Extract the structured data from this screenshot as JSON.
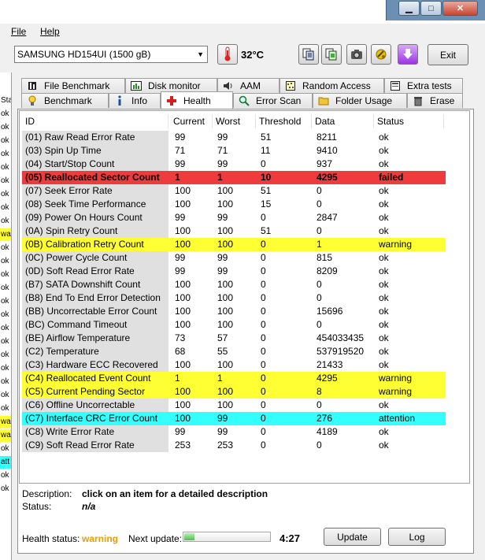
{
  "window": {
    "caption_buttons": {
      "minimize": "▁",
      "maximize": "□",
      "close": "✕"
    }
  },
  "menu": {
    "file": "File",
    "help": "Help"
  },
  "toolbar": {
    "drive": "SAMSUNG HD154UI (1500 gB)",
    "temperature": "32°C",
    "exit_label": "Exit",
    "icons": [
      "thermometer-icon",
      "copy-text-icon",
      "copy-image-icon",
      "camera-icon",
      "tools-icon",
      "download-icon"
    ]
  },
  "tabs": {
    "row1": [
      "File Benchmark",
      "Disk monitor",
      "AAM",
      "Random Access",
      "Extra tests"
    ],
    "row2": [
      "Benchmark",
      "Info",
      "Health",
      "Error Scan",
      "Folder Usage",
      "Erase"
    ],
    "active": "Health"
  },
  "table": {
    "columns": [
      "ID",
      "Current",
      "Worst",
      "Threshold",
      "Data",
      "Status"
    ],
    "rows": [
      {
        "id": "(01) Raw Read Error Rate",
        "current": "99",
        "worst": "99",
        "threshold": "51",
        "data": "8211",
        "status": "ok",
        "highlight": "none"
      },
      {
        "id": "(03) Spin Up Time",
        "current": "71",
        "worst": "71",
        "threshold": "11",
        "data": "9410",
        "status": "ok",
        "highlight": "none"
      },
      {
        "id": "(04) Start/Stop Count",
        "current": "99",
        "worst": "99",
        "threshold": "0",
        "data": "937",
        "status": "ok",
        "highlight": "none"
      },
      {
        "id": "(05) Reallocated Sector Count",
        "current": "1",
        "worst": "1",
        "threshold": "10",
        "data": "4295",
        "status": "failed",
        "highlight": "red"
      },
      {
        "id": "(07) Seek Error Rate",
        "current": "100",
        "worst": "100",
        "threshold": "51",
        "data": "0",
        "status": "ok",
        "highlight": "none"
      },
      {
        "id": "(08) Seek Time Performance",
        "current": "100",
        "worst": "100",
        "threshold": "15",
        "data": "0",
        "status": "ok",
        "highlight": "none"
      },
      {
        "id": "(09) Power On Hours Count",
        "current": "99",
        "worst": "99",
        "threshold": "0",
        "data": "2847",
        "status": "ok",
        "highlight": "none"
      },
      {
        "id": "(0A) Spin Retry Count",
        "current": "100",
        "worst": "100",
        "threshold": "51",
        "data": "0",
        "status": "ok",
        "highlight": "none"
      },
      {
        "id": "(0B) Calibration Retry Count",
        "current": "100",
        "worst": "100",
        "threshold": "0",
        "data": "1",
        "status": "warning",
        "highlight": "yellow"
      },
      {
        "id": "(0C) Power Cycle Count",
        "current": "99",
        "worst": "99",
        "threshold": "0",
        "data": "815",
        "status": "ok",
        "highlight": "none"
      },
      {
        "id": "(0D) Soft Read Error Rate",
        "current": "99",
        "worst": "99",
        "threshold": "0",
        "data": "8209",
        "status": "ok",
        "highlight": "none"
      },
      {
        "id": "(B7) SATA Downshift Count",
        "current": "100",
        "worst": "100",
        "threshold": "0",
        "data": "0",
        "status": "ok",
        "highlight": "none"
      },
      {
        "id": "(B8) End To End Error Detection",
        "current": "100",
        "worst": "100",
        "threshold": "0",
        "data": "0",
        "status": "ok",
        "highlight": "none"
      },
      {
        "id": "(BB) Uncorrectable Error Count",
        "current": "100",
        "worst": "100",
        "threshold": "0",
        "data": "15696",
        "status": "ok",
        "highlight": "none"
      },
      {
        "id": "(BC) Command Timeout",
        "current": "100",
        "worst": "100",
        "threshold": "0",
        "data": "0",
        "status": "ok",
        "highlight": "none"
      },
      {
        "id": "(BE) Airflow Temperature",
        "current": "73",
        "worst": "57",
        "threshold": "0",
        "data": "454033435",
        "status": "ok",
        "highlight": "none"
      },
      {
        "id": "(C2) Temperature",
        "current": "68",
        "worst": "55",
        "threshold": "0",
        "data": "537919520",
        "status": "ok",
        "highlight": "none"
      },
      {
        "id": "(C3) Hardware ECC Recovered",
        "current": "100",
        "worst": "100",
        "threshold": "0",
        "data": "21433",
        "status": "ok",
        "highlight": "none"
      },
      {
        "id": "(C4) Reallocated Event Count",
        "current": "1",
        "worst": "1",
        "threshold": "0",
        "data": "4295",
        "status": "warning",
        "highlight": "yellow"
      },
      {
        "id": "(C5) Current Pending Sector",
        "current": "100",
        "worst": "100",
        "threshold": "0",
        "data": "8",
        "status": "warning",
        "highlight": "yellow"
      },
      {
        "id": "(C6) Offline Uncorrectable",
        "current": "100",
        "worst": "100",
        "threshold": "0",
        "data": "0",
        "status": "ok",
        "highlight": "none"
      },
      {
        "id": "(C7) Interface CRC Error Count",
        "current": "100",
        "worst": "99",
        "threshold": "0",
        "data": "276",
        "status": "attention",
        "highlight": "cyan"
      },
      {
        "id": "(C8) Write Error Rate",
        "current": "99",
        "worst": "99",
        "threshold": "0",
        "data": "4189",
        "status": "ok",
        "highlight": "none"
      },
      {
        "id": "(C9) Soft Read Error Rate",
        "current": "253",
        "worst": "253",
        "threshold": "0",
        "data": "0",
        "status": "ok",
        "highlight": "none"
      }
    ]
  },
  "details": {
    "description_label": "Description:",
    "description_value": "click on an item for a detailed description",
    "status_label": "Status:",
    "status_value": "n/a"
  },
  "footer": {
    "health_label": "Health status:",
    "health_value": "warning",
    "next_update_label": "Next update:",
    "next_update_progress": 0.12,
    "next_update_time": "4:27",
    "update_button": "Update",
    "log_button": "Log"
  },
  "background_window_fragment": [
    "Sta",
    "ok",
    "ok",
    "ok",
    "ok",
    "ok",
    "ok",
    "ok",
    "ok",
    "ok",
    "wa",
    "ok",
    "ok",
    "ok",
    "ok",
    "ok",
    "ok",
    "ok",
    "ok",
    "ok",
    "ok",
    "ok",
    "ok",
    "ok",
    "wa",
    "wa",
    "ok",
    "att",
    "ok",
    "ok"
  ],
  "colors": {
    "red_row": "#ee3b3b",
    "yellow_row": "#ffff33",
    "cyan_row": "#33ffff",
    "id_column_bg": "#e0e0e0",
    "warning_text": "#e8a000"
  }
}
